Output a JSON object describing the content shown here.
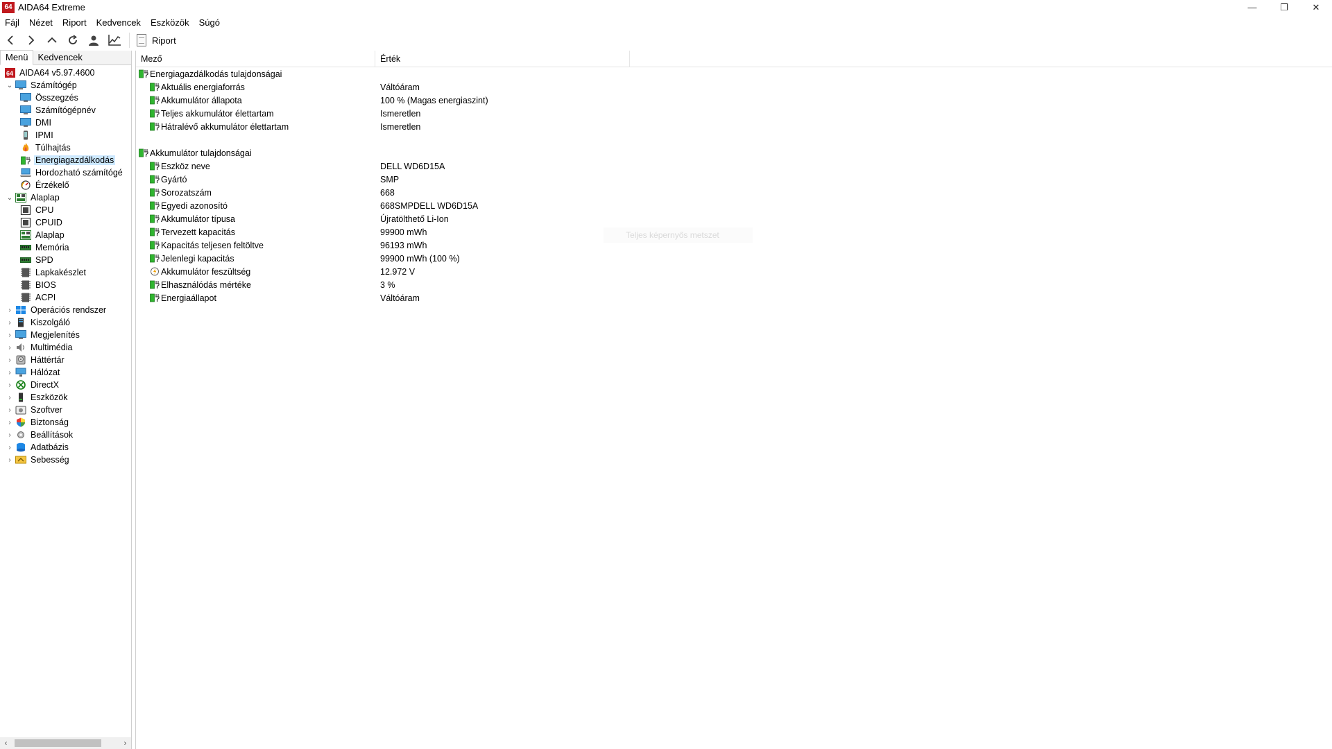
{
  "window": {
    "logo_text": "64",
    "title": "AIDA64 Extreme",
    "controls": {
      "minimize": "—",
      "restore": "❐",
      "close": "✕"
    }
  },
  "menubar": {
    "items": [
      "Fájl",
      "Nézet",
      "Riport",
      "Kedvencek",
      "Eszközök",
      "Súgó"
    ]
  },
  "toolbar": {
    "icons": [
      "back-icon",
      "forward-icon",
      "up-icon",
      "refresh-icon",
      "user-icon",
      "chart-icon"
    ],
    "report_label": "Riport"
  },
  "left_panel": {
    "tabs": [
      {
        "label": "Menü",
        "active": true
      },
      {
        "label": "Kedvencek",
        "active": false
      }
    ],
    "tree": [
      {
        "label": "AIDA64 v5.97.4600",
        "level": 0,
        "expander": "",
        "icon": "aida-icon"
      },
      {
        "label": "Számítógép",
        "level": 0,
        "expander": "open",
        "icon": "computer-icon"
      },
      {
        "label": "Összegzés",
        "level": 1,
        "icon": "monitor-icon"
      },
      {
        "label": "Számítógépnév",
        "level": 1,
        "icon": "monitor-icon"
      },
      {
        "label": "DMI",
        "level": 1,
        "icon": "monitor-icon"
      },
      {
        "label": "IPMI",
        "level": 1,
        "icon": "phone-icon"
      },
      {
        "label": "Túlhajtás",
        "level": 1,
        "icon": "flame-icon"
      },
      {
        "label": "Energiagazdálkodás",
        "level": 1,
        "icon": "battery-icon",
        "selected": true
      },
      {
        "label": "Hordozható számítógé",
        "level": 1,
        "icon": "laptop-icon"
      },
      {
        "label": "Érzékelő",
        "level": 1,
        "icon": "gauge-icon"
      },
      {
        "label": "Alaplap",
        "level": 0,
        "expander": "open",
        "icon": "motherboard-icon"
      },
      {
        "label": "CPU",
        "level": 1,
        "icon": "chip-icon"
      },
      {
        "label": "CPUID",
        "level": 1,
        "icon": "chip-icon"
      },
      {
        "label": "Alaplap",
        "level": 1,
        "icon": "motherboard-icon"
      },
      {
        "label": "Memória",
        "level": 1,
        "icon": "ram-icon"
      },
      {
        "label": "SPD",
        "level": 1,
        "icon": "ram-icon"
      },
      {
        "label": "Lapkakészlet",
        "level": 1,
        "icon": "chipset-icon"
      },
      {
        "label": "BIOS",
        "level": 1,
        "icon": "chipset-icon"
      },
      {
        "label": "ACPI",
        "level": 1,
        "icon": "chipset-icon"
      },
      {
        "label": "Operációs rendszer",
        "level": 0,
        "expander": "closed",
        "icon": "windows-icon"
      },
      {
        "label": "Kiszolgáló",
        "level": 0,
        "expander": "closed",
        "icon": "server-icon"
      },
      {
        "label": "Megjelenítés",
        "level": 0,
        "expander": "closed",
        "icon": "display-icon"
      },
      {
        "label": "Multimédia",
        "level": 0,
        "expander": "closed",
        "icon": "speaker-icon"
      },
      {
        "label": "Háttértár",
        "level": 0,
        "expander": "closed",
        "icon": "storage-icon"
      },
      {
        "label": "Hálózat",
        "level": 0,
        "expander": "closed",
        "icon": "network-icon"
      },
      {
        "label": "DirectX",
        "level": 0,
        "expander": "closed",
        "icon": "xbox-icon"
      },
      {
        "label": "Eszközök",
        "level": 0,
        "expander": "closed",
        "icon": "devices-icon"
      },
      {
        "label": "Szoftver",
        "level": 0,
        "expander": "closed",
        "icon": "software-icon"
      },
      {
        "label": "Biztonság",
        "level": 0,
        "expander": "closed",
        "icon": "shield-icon"
      },
      {
        "label": "Beállítások",
        "level": 0,
        "expander": "closed",
        "icon": "settings-icon"
      },
      {
        "label": "Adatbázis",
        "level": 0,
        "expander": "closed",
        "icon": "database-icon"
      },
      {
        "label": "Sebesség",
        "level": 0,
        "expander": "closed",
        "icon": "speed-icon"
      }
    ]
  },
  "table": {
    "columns": {
      "field": "Mező",
      "value": "Érték"
    },
    "rows": [
      {
        "type": "group",
        "field": "Energiagazdálkodás tulajdonságai",
        "value": ""
      },
      {
        "type": "item",
        "field": "Aktuális energiaforrás",
        "value": "Váltóáram",
        "icon": "battery-icon"
      },
      {
        "type": "item",
        "field": "Akkumulátor állapota",
        "value": "100 % (Magas energiaszint)",
        "icon": "battery-icon"
      },
      {
        "type": "item",
        "field": "Teljes akkumulátor élettartam",
        "value": "Ismeretlen",
        "icon": "battery-icon"
      },
      {
        "type": "item",
        "field": "Hátralévő akkumulátor élettartam",
        "value": "Ismeretlen",
        "icon": "battery-icon"
      },
      {
        "type": "blank"
      },
      {
        "type": "group",
        "field": "Akkumulátor tulajdonságai",
        "value": ""
      },
      {
        "type": "item",
        "field": "Eszköz neve",
        "value": "DELL WD6D15A",
        "icon": "battery-icon"
      },
      {
        "type": "item",
        "field": "Gyártó",
        "value": "SMP",
        "icon": "battery-icon"
      },
      {
        "type": "item",
        "field": "Sorozatszám",
        "value": "668",
        "icon": "battery-icon"
      },
      {
        "type": "item",
        "field": "Egyedi azonosító",
        "value": "668SMPDELL WD6D15A",
        "icon": "battery-icon"
      },
      {
        "type": "item",
        "field": "Akkumulátor típusa",
        "value": "Újratölthető Li-Ion",
        "icon": "battery-icon"
      },
      {
        "type": "item",
        "field": "Tervezett kapacitás",
        "value": "99900 mWh",
        "icon": "battery-icon"
      },
      {
        "type": "item",
        "field": "Kapacitás teljesen feltöltve",
        "value": "96193 mWh",
        "icon": "battery-icon"
      },
      {
        "type": "item",
        "field": "Jelenlegi kapacitás",
        "value": "99900 mWh  (100 %)",
        "icon": "battery-icon"
      },
      {
        "type": "item",
        "field": "Akkumulátor feszültség",
        "value": "12.972 V",
        "icon": "voltage-icon"
      },
      {
        "type": "item",
        "field": "Elhasználódás mértéke",
        "value": "3 %",
        "icon": "battery-icon"
      },
      {
        "type": "item",
        "field": "Energiaállapot",
        "value": "Váltóáram",
        "icon": "battery-icon"
      }
    ]
  },
  "ghost_tooltip": "Teljes képernyős metszet",
  "colors": {
    "selection": "#cce8ff",
    "battery_green": "#2fb52f",
    "logo_red": "#c0191e"
  }
}
